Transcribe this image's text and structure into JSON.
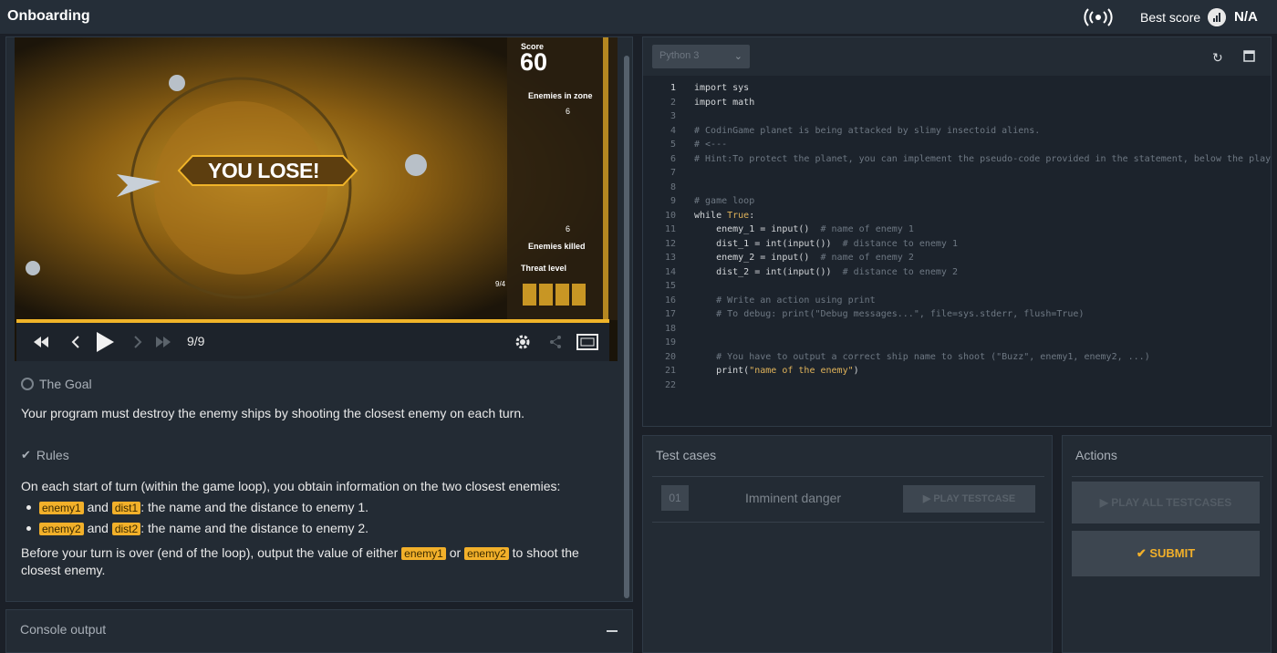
{
  "header": {
    "title": "Onboarding",
    "broadcast_icon": "broadcast-icon",
    "best_score_label": "Best score",
    "best_score_value": "N/A"
  },
  "viewer": {
    "banner": "YOU LOSE!",
    "score_label": "Score",
    "score_value": "60",
    "enemies_in_zone_label": "Enemies in zone",
    "enemies_in_zone_value": "6",
    "enemies_killed_label": "Enemies killed",
    "enemies_killed_value": "6",
    "threat_label": "Threat level",
    "threat_value": "9/4",
    "frame_counter": "9/9",
    "progress_fraction": 1.0
  },
  "statement": {
    "goal_title": "The Goal",
    "goal_text": "Your program must destroy the enemy ships by shooting the closest enemy on each turn.",
    "rules_title": "Rules",
    "rules_intro": "On each start of turn (within the game loop), you obtain information on the two closest enemies:",
    "bullets": [
      {
        "tag1": "enemy1",
        "and": "and",
        "tag2": "dist1",
        "text": ": the name and the distance to enemy 1."
      },
      {
        "tag1": "enemy2",
        "and": "and",
        "tag2": "dist2",
        "text": ": the name and the distance to enemy 2."
      }
    ],
    "outro_1": "Before your turn is over (end of the loop), output the value of either",
    "outro_tag1": "enemy1",
    "outro_or": "or",
    "outro_tag2": "enemy2",
    "outro_2": "to shoot the",
    "outro_3": "closest enemy."
  },
  "console": {
    "title": "Console output"
  },
  "editor": {
    "language": "Python 3",
    "lines": [
      "import sys",
      "import math",
      "",
      "# CodinGame planet is being attacked by slimy insectoid aliens.",
      "# <---",
      "# Hint:To protect the planet, you can implement the pseudo-code provided in the statement, below the player.",
      "",
      "",
      "# game loop",
      "while True:",
      "    enemy_1 = input()  # name of enemy 1",
      "    dist_1 = int(input())  # distance to enemy 1",
      "    enemy_2 = input()  # name of enemy 2",
      "    dist_2 = int(input())  # distance to enemy 2",
      "",
      "    # Write an action using print",
      "    # To debug: print(\"Debug messages...\", file=sys.stderr, flush=True)",
      "",
      "",
      "    # You have to output a correct ship name to shoot (\"Buzz\", enemy1, enemy2, ...)",
      "    print(\"name of the enemy\")",
      ""
    ]
  },
  "tests": {
    "title": "Test cases",
    "items": [
      {
        "index": "01",
        "name": "Imminent danger",
        "play_label": "PLAY TESTCASE"
      }
    ]
  },
  "actions": {
    "title": "Actions",
    "play_all_label": "PLAY ALL TESTCASES",
    "submit_label": "SUBMIT"
  },
  "colors": {
    "accent": "#f2b02a",
    "panel": "#232b34",
    "background": "#1b2028"
  }
}
